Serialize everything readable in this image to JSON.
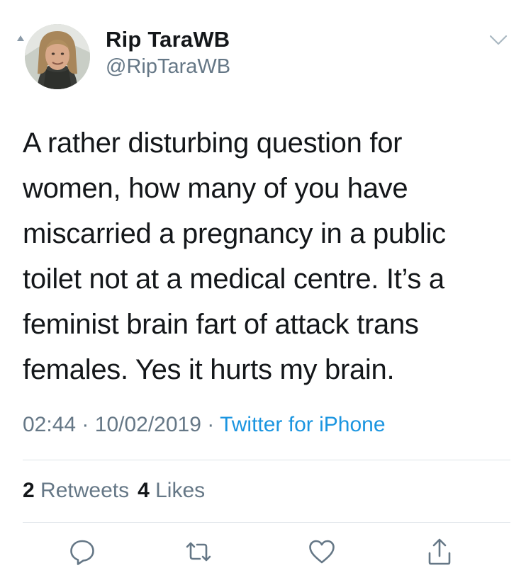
{
  "author": {
    "name": "Rip TaraWB",
    "handle": "@RipTaraWB",
    "avatar_icon": "profile-photo"
  },
  "tweet": {
    "lines": [
      "A rather disturbing question for",
      "women,  how many of you have",
      "miscarried a pregnancy in a public",
      "toilet not at a medical centre.  It’s a",
      "feminist brain fart of attack trans",
      "females.  Yes it hurts my brain."
    ],
    "time": "02:44",
    "date": "10/02/2019",
    "source": "Twitter for iPhone",
    "separator": "·"
  },
  "stats": {
    "retweets_count": "2",
    "retweets_label": "Retweets",
    "likes_count": "4",
    "likes_label": "Likes"
  },
  "actions": [
    "reply-icon",
    "retweet-icon",
    "like-icon",
    "share-icon"
  ],
  "colors": {
    "text": "#14171a",
    "secondary": "#657786",
    "link": "#1b95e0",
    "divider": "#dde3e8"
  }
}
